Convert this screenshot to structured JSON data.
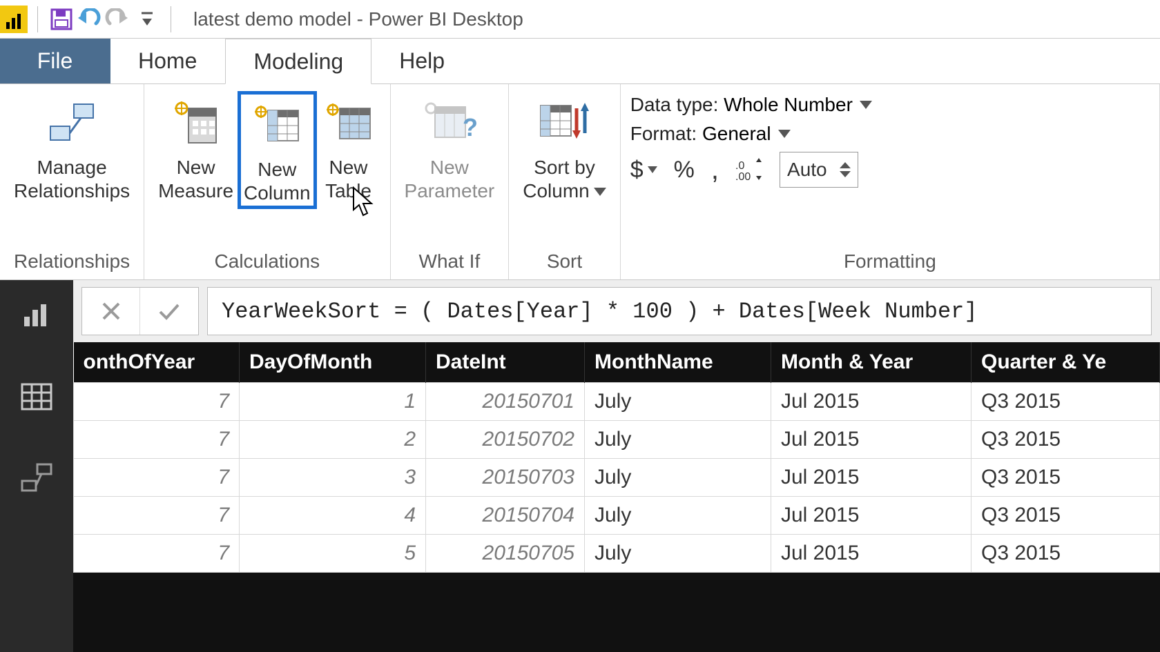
{
  "title": "latest demo model - Power BI Desktop",
  "tabs": {
    "file": "File",
    "home": "Home",
    "modeling": "Modeling",
    "help": "Help"
  },
  "ribbon": {
    "relationships": {
      "manage": "Manage\nRelationships",
      "group_label": "Relationships"
    },
    "calculations": {
      "new_measure": "New\nMeasure",
      "new_column": "New\nColumn",
      "new_table": "New\nTable",
      "group_label": "Calculations"
    },
    "whatif": {
      "new_parameter": "New\nParameter",
      "group_label": "What If"
    },
    "sort": {
      "sort_by_column": "Sort by\nColumn",
      "group_label": "Sort"
    },
    "formatting": {
      "data_type_label": "Data type:",
      "data_type_value": "Whole Number",
      "format_label": "Format:",
      "format_value": "General",
      "decimal_value": "Auto",
      "group_label": "Formatting"
    }
  },
  "formula": "YearWeekSort = ( Dates[Year] * 100 ) + Dates[Week Number]",
  "grid": {
    "columns": [
      "onthOfYear",
      "DayOfMonth",
      "DateInt",
      "MonthName",
      "Month & Year",
      "Quarter & Ye"
    ],
    "column_types": [
      "num",
      "num",
      "num",
      "txt",
      "txt",
      "txt"
    ],
    "rows": [
      [
        "7",
        "1",
        "20150701",
        "July",
        "Jul 2015",
        "Q3 2015"
      ],
      [
        "7",
        "2",
        "20150702",
        "July",
        "Jul 2015",
        "Q3 2015"
      ],
      [
        "7",
        "3",
        "20150703",
        "July",
        "Jul 2015",
        "Q3 2015"
      ],
      [
        "7",
        "4",
        "20150704",
        "July",
        "Jul 2015",
        "Q3 2015"
      ],
      [
        "7",
        "5",
        "20150705",
        "July",
        "Jul 2015",
        "Q3 2015"
      ]
    ]
  }
}
